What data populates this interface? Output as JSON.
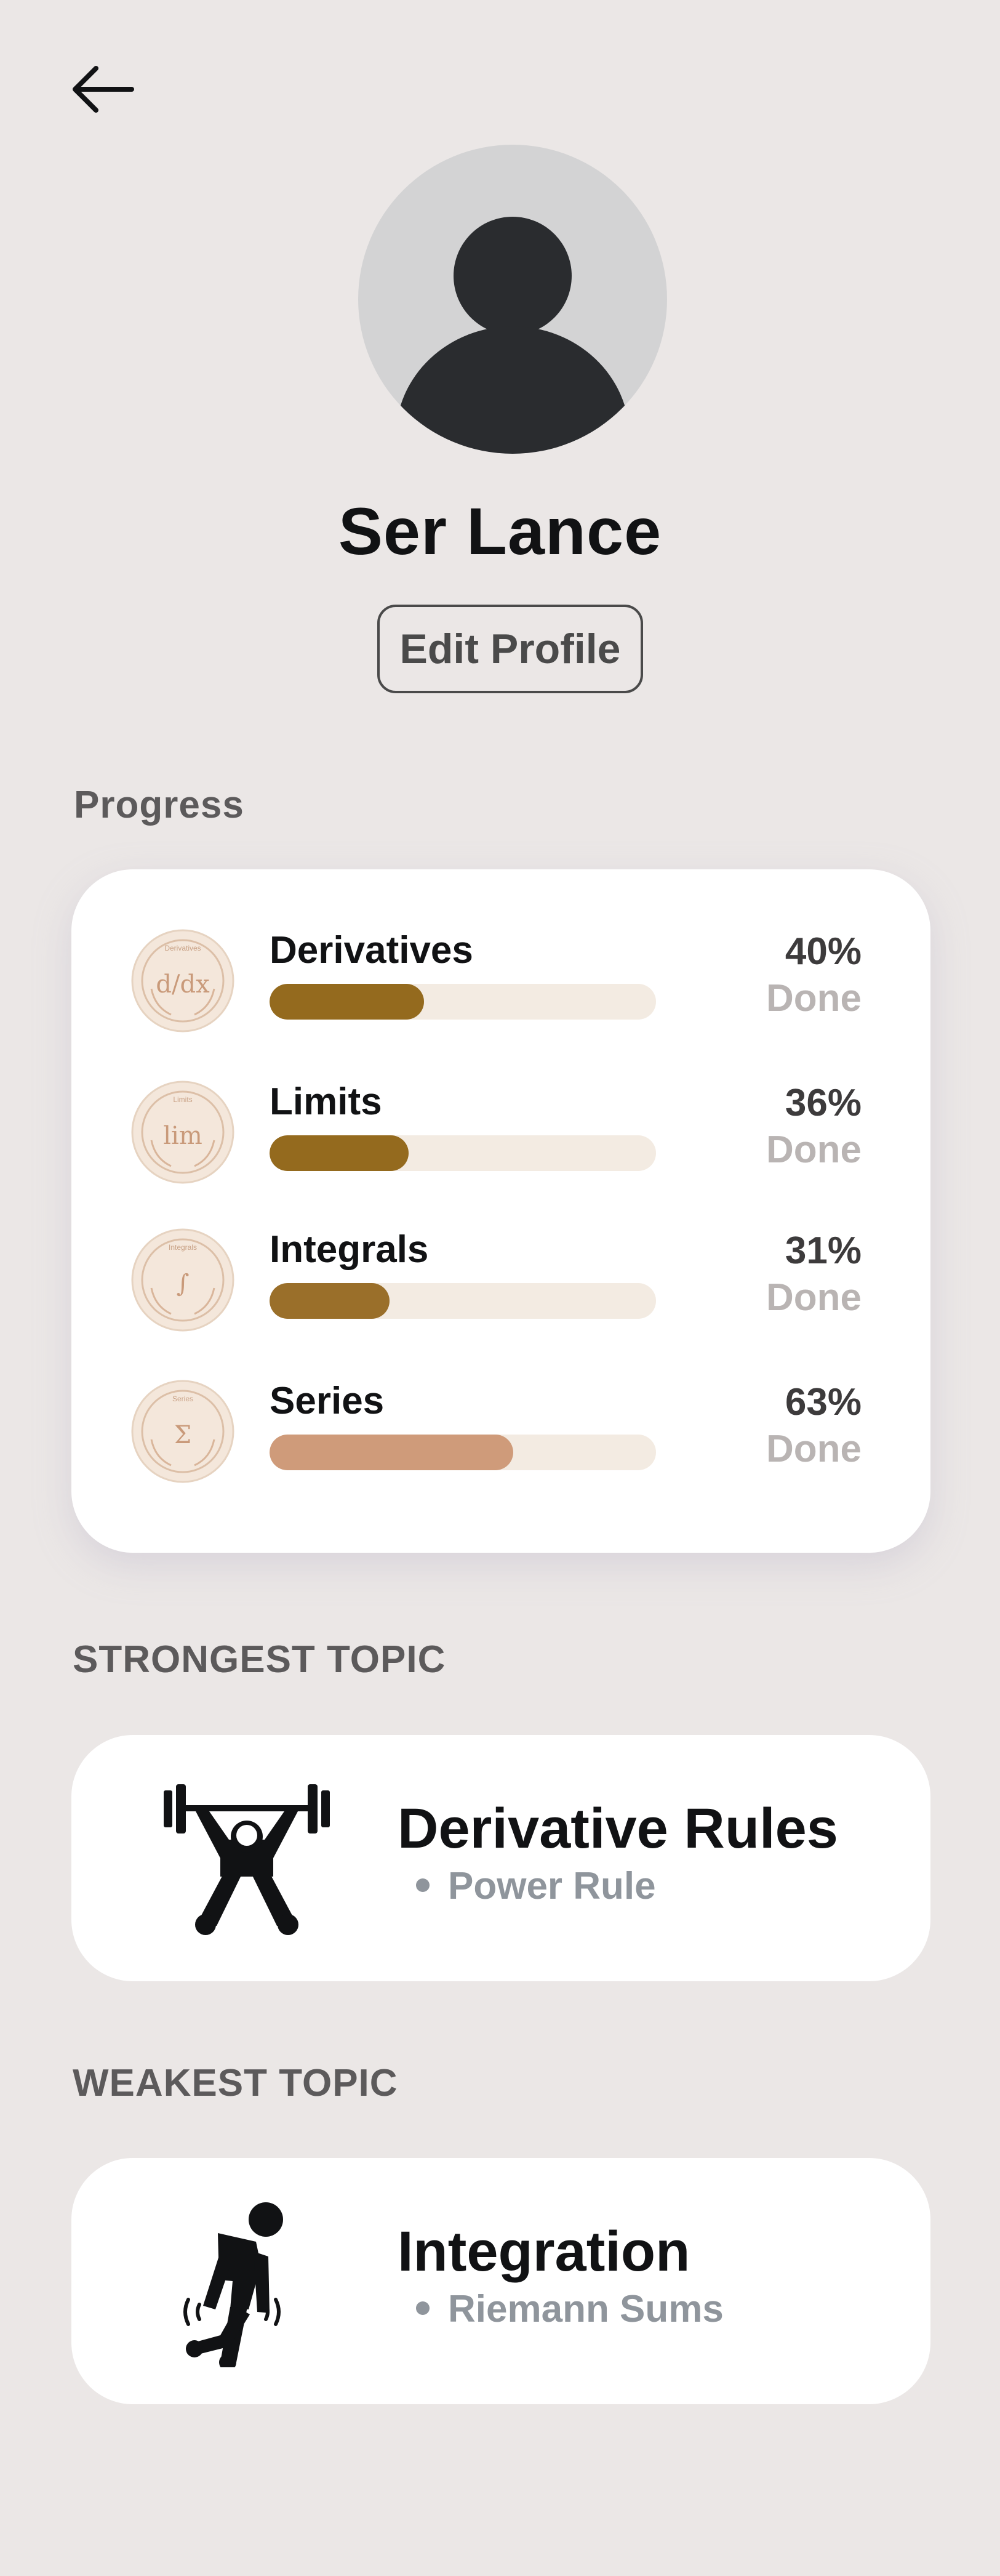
{
  "profile": {
    "name": "Ser Lance",
    "edit_label": "Edit Profile"
  },
  "progress": {
    "heading": "Progress",
    "items": [
      {
        "title": "Derivatives",
        "percent_label": "40%",
        "done_label": "Done",
        "fraction": 0.4,
        "badge_text": "d/dx",
        "badge_caption": "Derivatives",
        "fill_color": "#946a1e"
      },
      {
        "title": "Limits",
        "percent_label": "36%",
        "done_label": "Done",
        "fraction": 0.36,
        "badge_text": "lim",
        "badge_caption": "Limits",
        "fill_color": "#946a1e"
      },
      {
        "title": "Integrals",
        "percent_label": "31%",
        "done_label": "Done",
        "fraction": 0.31,
        "badge_text": "∫",
        "badge_caption": "Integrals",
        "fill_color": "#9a6f2a"
      },
      {
        "title": "Series",
        "percent_label": "63%",
        "done_label": "Done",
        "fraction": 0.63,
        "badge_text": "Σ",
        "badge_caption": "Series",
        "fill_color": "#cf9b7a"
      }
    ]
  },
  "strongest": {
    "heading": "STRONGEST TOPIC",
    "title": "Derivative Rules",
    "subtitle": "Power Rule",
    "icon": "weightlifter-icon"
  },
  "weakest": {
    "heading": "WEAKEST TOPIC",
    "title": "Integration",
    "subtitle": "Riemann Sums",
    "icon": "tired-person-icon"
  },
  "colors": {
    "background": "#ebe7e6",
    "card": "#ffffff",
    "bar_track": "#f3ebe2",
    "bar_fill_dark": "#946a1e",
    "bar_fill_light": "#cf9b7a",
    "muted_text": "#8f959c"
  }
}
